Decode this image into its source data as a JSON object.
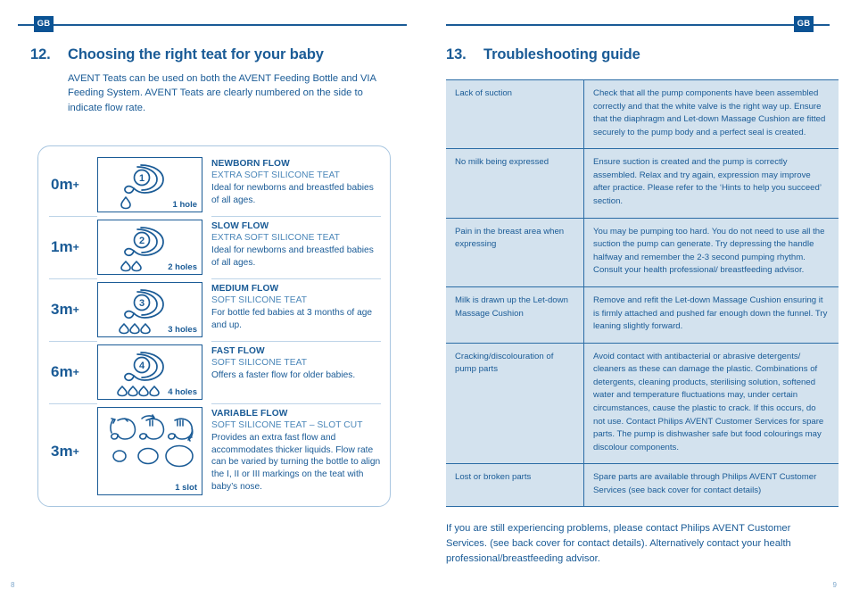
{
  "left_page": {
    "badge": "GB",
    "folio": "8",
    "section": {
      "number": "12.",
      "title": "Choosing the right teat for your baby"
    },
    "intro": "AVENT Teats can be used on both the AVENT Feeding Bottle and VIA Feeding System. AVENT Teats are clearly numbered on the side to indicate flow rate.",
    "teat_rows": [
      {
        "age": "0m",
        "age_sup": "+",
        "teat_number": "1",
        "drops": 1,
        "hole_label": "1 hole",
        "title": "NEWBORN FLOW",
        "subtitle": "EXTRA SOFT SILICONE TEAT",
        "body": "Ideal for newborns and breastfed babies of all ages."
      },
      {
        "age": "1m",
        "age_sup": "+",
        "teat_number": "2",
        "drops": 2,
        "hole_label": "2 holes",
        "title": "SLOW FLOW",
        "subtitle": "EXTRA SOFT SILICONE TEAT",
        "body": "Ideal for newborns and breastfed babies of all ages."
      },
      {
        "age": "3m",
        "age_sup": "+",
        "teat_number": "3",
        "drops": 3,
        "hole_label": "3 holes",
        "title": "MEDIUM FLOW",
        "subtitle": "SOFT SILICONE TEAT",
        "body": "For bottle fed babies at 3 months of age and up."
      },
      {
        "age": "6m",
        "age_sup": "+",
        "teat_number": "4",
        "drops": 4,
        "hole_label": "4 holes",
        "title": "FAST FLOW",
        "subtitle": "SOFT SILICONE TEAT",
        "body": "Offers a faster flow for older babies."
      },
      {
        "age": "3m",
        "age_sup": "+",
        "teat_number": "variable",
        "drops": 0,
        "hole_label": "1 slot",
        "title": "VARIABLE FLOW",
        "subtitle": "SOFT SILICONE TEAT – SLOT CUT",
        "body": "Provides an extra fast flow and accommodates thicker liquids. Flow rate can be varied by turning the bottle to align the I, II or III markings on the teat with baby’s nose."
      }
    ]
  },
  "right_page": {
    "badge": "GB",
    "folio": "9",
    "section": {
      "number": "13.",
      "title": "Troubleshooting guide"
    },
    "troubleshooting_rows": [
      {
        "problem": "Lack of suction",
        "solution": "Check that all the pump components have been assembled correctly and that the white valve is the right way up. Ensure that the diaphragm and Let-down Massage Cushion are fitted securely to the pump body and a perfect seal is created."
      },
      {
        "problem": "No milk being expressed",
        "solution": "Ensure suction is created and the pump is correctly assembled. Relax and try again, expression may improve after practice. Please refer to the ‘Hints to help you succeed’ section."
      },
      {
        "problem": "Pain in the breast area when expressing",
        "solution": "You may be pumping too hard. You do not need to use all the suction the pump can generate. Try depressing the handle halfway and remember the 2-3 second pumping rhythm. Consult your health professional/ breastfeeding advisor."
      },
      {
        "problem": "Milk is drawn up the Let-down Massage Cushion",
        "solution": "Remove and refit the Let-down Massage Cushion ensuring it is firmly attached and pushed far enough down the funnel. Try leaning slightly forward."
      },
      {
        "problem": "Cracking/discolouration of pump parts",
        "solution": "Avoid contact with antibacterial or abrasive detergents/ cleaners as these can damage the plastic. Combinations of detergents, cleaning products, sterilising solution, softened water and temperature fluctuations may, under certain circumstances, cause the plastic to crack. If this occurs, do not use. Contact Philips AVENT Customer Services for spare parts. The pump is dishwasher safe but food colourings may discolour components."
      },
      {
        "problem": "Lost or broken parts",
        "solution": "Spare parts are available through Philips AVENT Customer Services (see back cover for contact details)"
      }
    ],
    "closing": "If you are still experiencing problems, please contact Philips AVENT Customer Services. (see back cover for contact details). Alternatively contact your health professional/breastfeeding advisor."
  },
  "colors": {
    "brand_blue": "#1a5b96",
    "badge_blue": "#0b5394",
    "table_fill": "#d3e2ee",
    "table_rule": "#2a6ca5",
    "light_rule": "#bdd4e8",
    "folio": "#7fa8cc"
  }
}
